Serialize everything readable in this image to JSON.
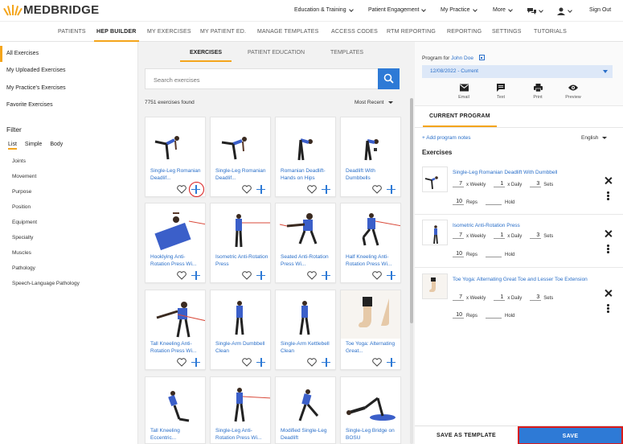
{
  "brand": {
    "name": "MEDBRIDGE",
    "accent": "#f4a51c",
    "blue": "#2e7ad6",
    "highlight": "#d91b1b"
  },
  "topmenu": {
    "education": "Education & Training",
    "engagement": "Patient Engagement",
    "practice": "My Practice",
    "more": "More",
    "signout": "Sign Out"
  },
  "nav": {
    "tabs": [
      "PATIENTS",
      "HEP BUILDER",
      "MY EXERCISES",
      "MY PATIENT ED.",
      "MANAGE TEMPLATES",
      "ACCESS CODES",
      "RTM REPORTING",
      "REPORTING",
      "SETTINGS",
      "TUTORIALS"
    ],
    "active": "HEP BUILDER"
  },
  "sidebar": {
    "items": [
      "All Exercises",
      "My Uploaded Exercises",
      "My Practice's Exercises",
      "Favorite Exercises"
    ],
    "active": "All Exercises",
    "filter_title": "Filter",
    "filter_tabs": [
      "List",
      "Simple",
      "Body"
    ],
    "facets": [
      "Joints",
      "Movement",
      "Purpose",
      "Position",
      "Equipment",
      "Specialty",
      "Muscles",
      "Pathology",
      "Speech-Language Pathology"
    ]
  },
  "library": {
    "tabs": [
      "EXERCISES",
      "PATIENT EDUCATION",
      "TEMPLATES"
    ],
    "active_tab": "EXERCISES",
    "search_placeholder": "Search exercises",
    "count_text": "7751 exercises found",
    "sort_label": "Most Recent",
    "cards": [
      "Single-Leg Romanian Deadlif...",
      "Single-Leg Romanian Deadlif...",
      "Romanian Deadlift- Hands on Hips",
      "Deadlift With Dumbbells",
      "Hooklying Anti-Rotation Press Wi...",
      "Isometric Anti-Rotation Press",
      "Seated Anti-Rotation Press Wi...",
      "Half Kneeling Anti-Rotation Press Wi...",
      "Tall Kneeling Anti-Rotation Press Wi...",
      "Single-Arm Dumbbell Clean",
      "Single-Arm Kettlebell Clean",
      "Toe Yoga: Alternating Great...",
      "Tall Kneeling Eccentric...",
      "Single-Leg Anti-Rotation Press Wi...",
      "Modified Single-Leg Deadlift",
      "Single-Leg Bridge on BOSU"
    ]
  },
  "program": {
    "for_label": "Program for",
    "patient": "John Doe",
    "date": "12/08/2022 - Current",
    "actions": [
      "Email",
      "Text",
      "Print",
      "Preview"
    ],
    "current_tab": "CURRENT PROGRAM",
    "add_notes": "+ Add program notes",
    "language": "English",
    "exercises_heading": "Exercises",
    "exercises": [
      {
        "title": "Single-Leg Romanian Deadlift With Dumbbell",
        "weekly": "7",
        "daily": "1",
        "sets": "3",
        "reps": "10"
      },
      {
        "title": "Isometric Anti-Rotation Press",
        "weekly": "7",
        "daily": "1",
        "sets": "3",
        "reps": "10"
      },
      {
        "title": "Toe Yoga: Alternating Great Toe and Lesser Toe Extension",
        "weekly": "7",
        "daily": "1",
        "sets": "3",
        "reps": "10"
      }
    ],
    "labels": {
      "weekly": "x Weekly",
      "daily": "x Daily",
      "sets": "Sets",
      "reps": "Reps",
      "hold": "Hold"
    },
    "save_template": "SAVE AS TEMPLATE",
    "save": "SAVE"
  }
}
